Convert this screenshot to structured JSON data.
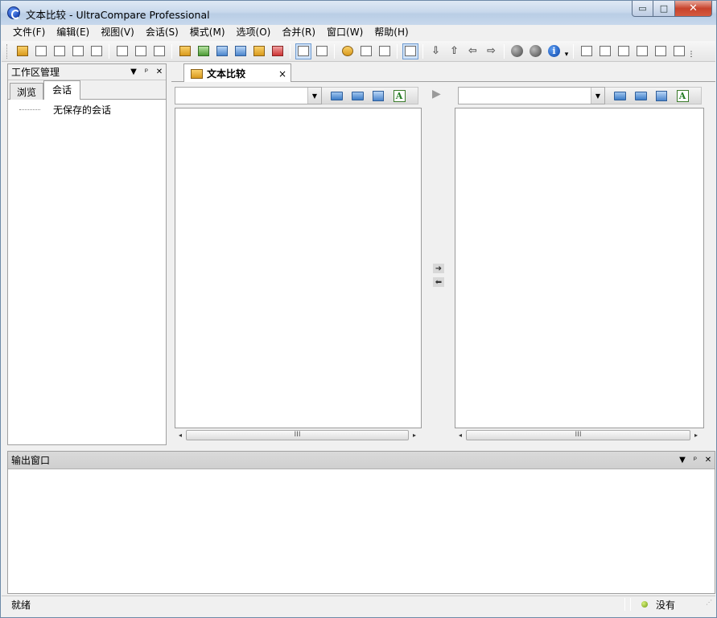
{
  "window": {
    "title": "文本比较 - UltraCompare Professional",
    "controls": {
      "minimize": "▭",
      "maximize": "□",
      "close": "✕"
    }
  },
  "menu": [
    "文件(F)",
    "编辑(E)",
    "视图(V)",
    "会话(S)",
    "模式(M)",
    "选项(O)",
    "合并(R)",
    "窗口(W)",
    "帮助(H)"
  ],
  "workspace": {
    "title": "工作区管理",
    "tabs": [
      "浏览",
      "会话"
    ],
    "active_tab": "会话",
    "tree": [
      "无保存的会话"
    ]
  },
  "document_tab": {
    "title": "文本比较",
    "close": "×"
  },
  "left_file": {
    "value": ""
  },
  "right_file": {
    "value": ""
  },
  "scroll_label": "III",
  "output": {
    "title": "输出窗口"
  },
  "status": {
    "text": "就绪",
    "right": "没有"
  },
  "icons": {
    "info_letter": "i",
    "font_letter": "A"
  }
}
